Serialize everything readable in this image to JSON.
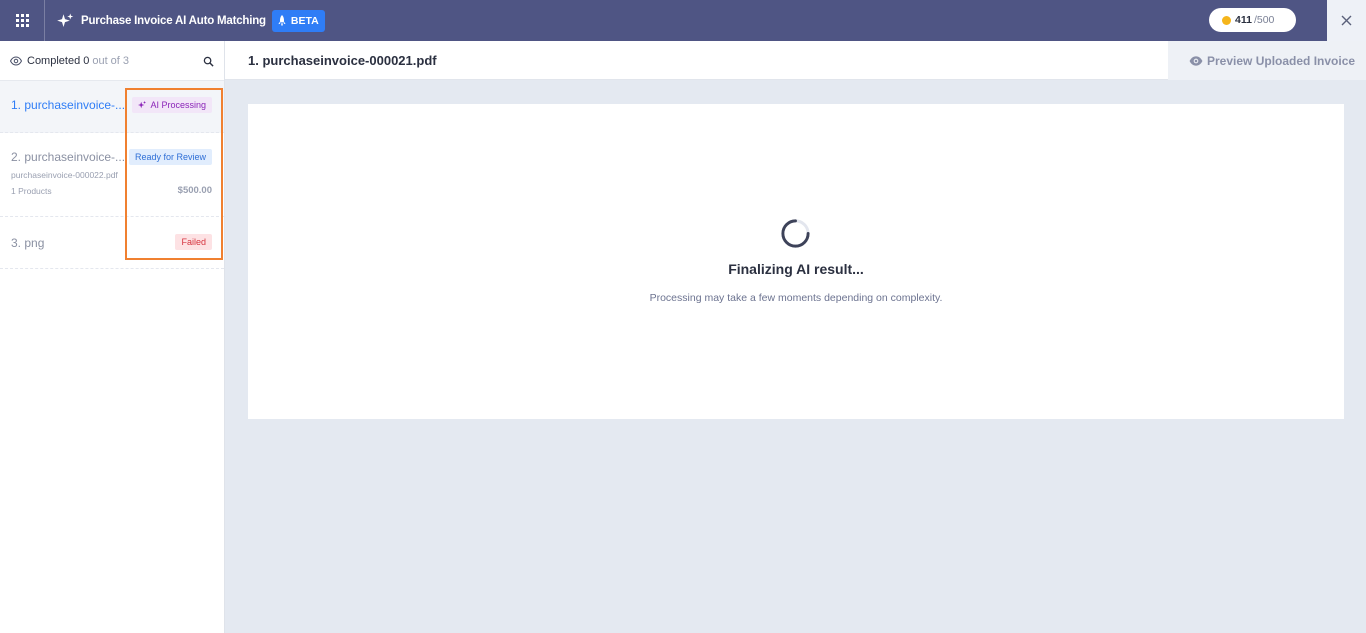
{
  "header": {
    "app_title": "Purchase Invoice AI Auto Matching",
    "beta_label": "BETA",
    "credits_used": "411",
    "credits_total": "/500",
    "accent": "#4f5584"
  },
  "sidebar": {
    "completed_label": "Completed",
    "completed_count": "0",
    "completed_of": "out of 3",
    "items": [
      {
        "name": "1. purchaseinvoice-...",
        "status": "AI Processing"
      },
      {
        "name": "2. purchaseinvoice-...",
        "status": "Ready for Review",
        "file": "purchaseinvoice-000022.pdf",
        "products": "1 Products",
        "amount": "$500.00"
      },
      {
        "name": "3. png",
        "status": "Failed"
      }
    ]
  },
  "main": {
    "doc_title": "1. purchaseinvoice-000021.pdf",
    "preview_label": "Preview Uploaded Invoice",
    "status_title": "Finalizing AI result...",
    "status_sub": "Processing may take a few moments depending on complexity."
  }
}
